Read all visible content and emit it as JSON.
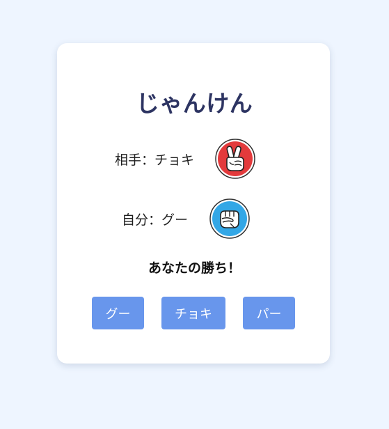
{
  "game": {
    "title": "じゃんけん",
    "opponent_label": "相手：チョキ",
    "self_label": "自分：グー",
    "result": "あなたの勝ち！"
  },
  "hands": {
    "opponent": {
      "icon": "scissors-hand-icon",
      "color": "#e33a3c"
    },
    "self": {
      "icon": "rock-fist-icon",
      "color": "#33a7e6"
    }
  },
  "buttons": {
    "rock": "グー",
    "scissors": "チョキ",
    "paper": "パー"
  },
  "colors": {
    "background": "#eef5ff",
    "title": "#2d3462",
    "button": "#6896ec"
  }
}
